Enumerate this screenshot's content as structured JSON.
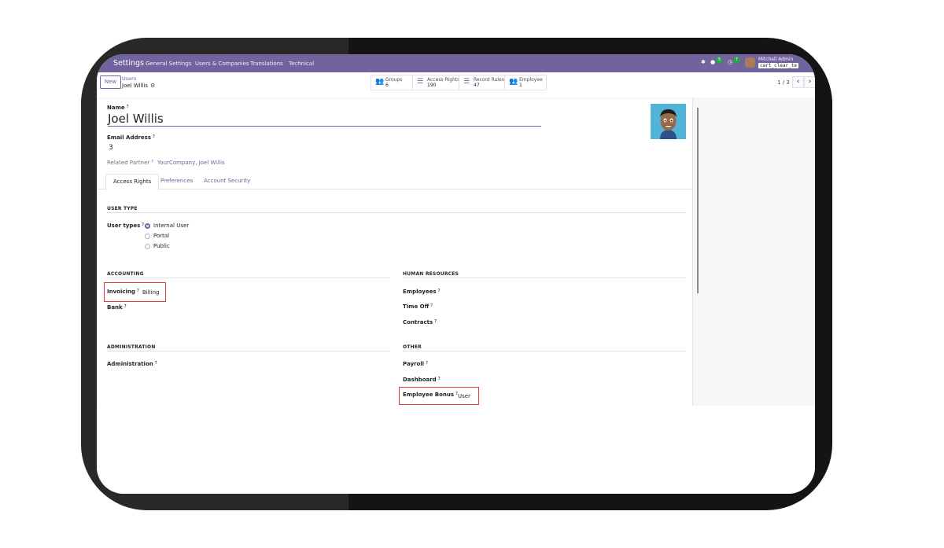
{
  "navbar": {
    "brand": "Settings",
    "menu": [
      "General Settings",
      "Users & Companies",
      "Translations",
      "Technical"
    ],
    "messages_count": "5",
    "activities_count": "7",
    "user_name": "Mitchell Admin",
    "database": "cart_clear_te"
  },
  "control_panel": {
    "new_label": "New",
    "breadcrumb_parent": "Users",
    "breadcrumb_current": "Joel Willis",
    "stats": [
      {
        "label": "Groups",
        "value": "6"
      },
      {
        "label": "Access Rights",
        "value": "190"
      },
      {
        "label": "Record Rules",
        "value": "47"
      },
      {
        "label": "Employee",
        "value": "1"
      }
    ],
    "pager": "1 / 3"
  },
  "form": {
    "name_label": "Name",
    "name_value": "Joel Willis",
    "email_label": "Email Address",
    "email_value": "3",
    "related_partner_label": "Related Partner",
    "related_partner_value": "YourCompany, Joel Willis",
    "help_mark": "?"
  },
  "tabs": [
    "Access Rights",
    "Preferences",
    "Account Security"
  ],
  "access_rights": {
    "user_type_section": "USER TYPE",
    "user_types_label": "User types",
    "user_type_options": [
      "Internal User",
      "Portal",
      "Public"
    ],
    "user_type_selected": "Internal User",
    "accounting_section": "ACCOUNTING",
    "invoicing_label": "Invoicing",
    "invoicing_value": "Billing",
    "bank_label": "Bank",
    "hr_section": "HUMAN RESOURCES",
    "employees_label": "Employees",
    "timeoff_label": "Time Off",
    "contracts_label": "Contracts",
    "administration_section": "ADMINISTRATION",
    "administration_label": "Administration",
    "other_section": "OTHER",
    "payroll_label": "Payroll",
    "dashboard_label": "Dashboard",
    "employee_bonus_label": "Employee Bonus",
    "employee_bonus_value": "User"
  },
  "colors": {
    "brand": "#71639e",
    "highlight": "#e53935",
    "help_mark": "#017e84"
  }
}
